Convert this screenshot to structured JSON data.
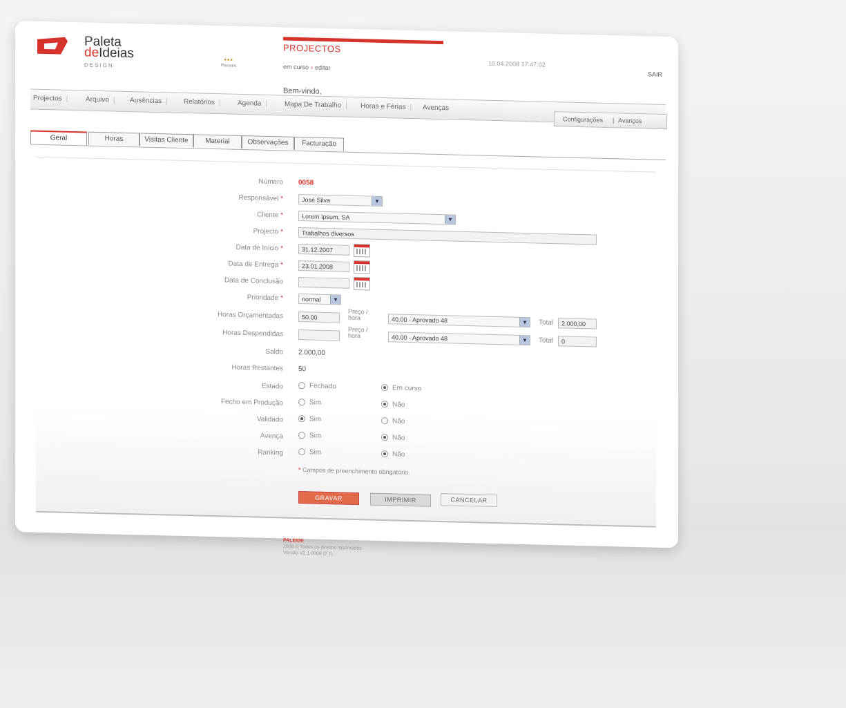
{
  "logo": {
    "line1": "Paleta",
    "line2a": "de",
    "line2b": "Ideias",
    "line3": "DESIGN"
  },
  "partner": {
    "label": "Parceiro"
  },
  "header": {
    "section_title": "PROJECTOS",
    "breadcrumb": [
      "em curso",
      "editar"
    ],
    "welcome": "Bem-vindo,",
    "datetime": "10.04.2008  17:47:02",
    "logout": "SAIR"
  },
  "nav": {
    "items": [
      "Projectos",
      "Arquivo",
      "Ausências",
      "Relatórios",
      "Agenda",
      "Mapa De Trabalho",
      "Horas e Férias",
      "Avenças"
    ],
    "right": [
      "Configurações",
      "Avanços"
    ]
  },
  "tabs": [
    "Geral",
    "Horas",
    "Visitas Cliente",
    "Material",
    "Observações",
    "Facturação"
  ],
  "form": {
    "numero": {
      "label": "Número",
      "value": "0058"
    },
    "responsavel": {
      "label": "Responsável",
      "value": "José Silva"
    },
    "cliente": {
      "label": "Cliente",
      "value": "Lorem Ipsum, SA"
    },
    "projecto": {
      "label": "Projecto",
      "value": "Trabalhos diversos"
    },
    "data_inicio": {
      "label": "Data de Início",
      "value": "31.12.2007"
    },
    "data_entrega": {
      "label": "Data de Entrega",
      "value": "23.01.2008"
    },
    "data_conclusao": {
      "label": "Data de Conclusão",
      "value": ""
    },
    "prioridade": {
      "label": "Prioridade",
      "value": "normal"
    },
    "horas_orcamentadas": {
      "label": "Horas Orçamentadas",
      "value": "50.00",
      "preco_label": "Preço / hora",
      "preco_value": "40.00 - Aprovado 48",
      "total_label": "Total",
      "total_value": "2.000,00"
    },
    "horas_despendidas": {
      "label": "Horas Despendidas",
      "value": "",
      "preco_label": "Preço / hora",
      "preco_value": "40.00 - Aprovado 48",
      "total_label": "Total",
      "total_value": "0"
    },
    "saldo": {
      "label": "Saldo",
      "value": "2.000,00"
    },
    "horas_restantes": {
      "label": "Horas Restantes",
      "value": "50"
    },
    "estado": {
      "label": "Estado",
      "opt1": "Fechado",
      "opt2": "Em curso"
    },
    "fecho_producao": {
      "label": "Fecho em Produção",
      "opt1": "Sim",
      "opt2": "Não"
    },
    "validado": {
      "label": "Validado",
      "opt1": "Sim",
      "opt2": "Não"
    },
    "avenca": {
      "label": "Avença",
      "opt1": "Sim",
      "opt2": "Não"
    },
    "ranking": {
      "label": "Ranking",
      "opt1": "Sim",
      "opt2": "Não"
    },
    "required_note": "Campos de preenchimento obrigatório."
  },
  "buttons": {
    "save": "GRAVAR",
    "print": "IMPRIMIR",
    "cancel": "CANCELAR"
  },
  "footer": {
    "brand": "PALEIDE",
    "line1": "2008 © Todos os direitos reservados",
    "line2": "Versão V2.1.0008 (2.1)"
  },
  "colors": {
    "accent": "#d6332b",
    "select_arrow": "#b8c6de"
  }
}
